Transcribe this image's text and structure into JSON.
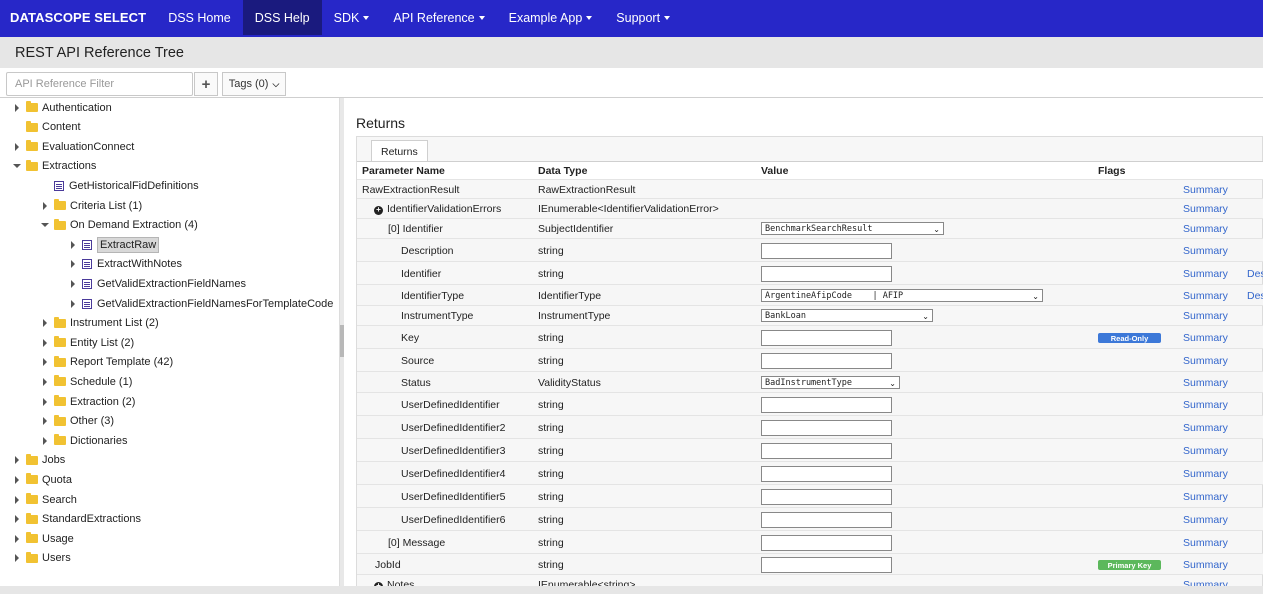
{
  "nav": {
    "brand": "DATASCOPE SELECT",
    "items": [
      {
        "label": "DSS Home",
        "caret": false,
        "active": false
      },
      {
        "label": "DSS Help",
        "caret": false,
        "active": true
      },
      {
        "label": "SDK",
        "caret": true,
        "active": false
      },
      {
        "label": "API Reference",
        "caret": true,
        "active": false
      },
      {
        "label": "Example App",
        "caret": true,
        "active": false
      },
      {
        "label": "Support",
        "caret": true,
        "active": false
      }
    ]
  },
  "page": {
    "title": "REST API Reference Tree"
  },
  "filter": {
    "placeholder": "API Reference Filter",
    "add_icon": "plus-icon",
    "tags_label": "Tags (0)"
  },
  "tree": [
    {
      "label": "Authentication",
      "level": 0,
      "toggle": "right",
      "icon": "folder"
    },
    {
      "label": "Content",
      "level": 0,
      "toggle": "none",
      "icon": "folder"
    },
    {
      "label": "EvaluationConnect",
      "level": 0,
      "toggle": "right",
      "icon": "folder"
    },
    {
      "label": "Extractions",
      "level": 0,
      "toggle": "down",
      "icon": "folder"
    },
    {
      "label": "GetHistoricalFidDefinitions",
      "level": 1,
      "toggle": "none",
      "icon": "method"
    },
    {
      "label": "Criteria List (1)",
      "level": 1,
      "toggle": "right",
      "icon": "folder"
    },
    {
      "label": "On Demand Extraction (4)",
      "level": 1,
      "toggle": "down",
      "icon": "folder"
    },
    {
      "label": "ExtractRaw",
      "level": 2,
      "toggle": "right",
      "icon": "method",
      "selected": true
    },
    {
      "label": "ExtractWithNotes",
      "level": 2,
      "toggle": "right",
      "icon": "method"
    },
    {
      "label": "GetValidExtractionFieldNames",
      "level": 2,
      "toggle": "right",
      "icon": "method"
    },
    {
      "label": "GetValidExtractionFieldNamesForTemplateCode",
      "level": 2,
      "toggle": "right",
      "icon": "method"
    },
    {
      "label": "Instrument List (2)",
      "level": 1,
      "toggle": "right",
      "icon": "folder"
    },
    {
      "label": "Entity List (2)",
      "level": 1,
      "toggle": "right",
      "icon": "folder"
    },
    {
      "label": "Report Template (42)",
      "level": 1,
      "toggle": "right",
      "icon": "folder"
    },
    {
      "label": "Schedule (1)",
      "level": 1,
      "toggle": "right",
      "icon": "folder"
    },
    {
      "label": "Extraction (2)",
      "level": 1,
      "toggle": "right",
      "icon": "folder"
    },
    {
      "label": "Other (3)",
      "level": 1,
      "toggle": "right",
      "icon": "folder"
    },
    {
      "label": "Dictionaries",
      "level": 1,
      "toggle": "right",
      "icon": "folder"
    },
    {
      "label": "Jobs",
      "level": 0,
      "toggle": "right",
      "icon": "folder"
    },
    {
      "label": "Quota",
      "level": 0,
      "toggle": "right",
      "icon": "folder"
    },
    {
      "label": "Search",
      "level": 0,
      "toggle": "right",
      "icon": "folder"
    },
    {
      "label": "StandardExtractions",
      "level": 0,
      "toggle": "right",
      "icon": "folder"
    },
    {
      "label": "Usage",
      "level": 0,
      "toggle": "right",
      "icon": "folder"
    },
    {
      "label": "Users",
      "level": 0,
      "toggle": "right",
      "icon": "folder"
    }
  ],
  "returns": {
    "heading": "Returns",
    "tab": "Returns",
    "columns": [
      "Parameter Name",
      "Data Type",
      "Value",
      "Flags"
    ],
    "rows": [
      {
        "name": "RawExtractionResult",
        "indent": 0,
        "type": "RawExtractionResult",
        "value_kind": "none",
        "flag": "",
        "link": "Summary",
        "extra": ""
      },
      {
        "name": "IdentifierValidationErrors",
        "indent": 1,
        "plus": true,
        "type": "IEnumerable<IdentifierValidationError>",
        "value_kind": "none",
        "flag": "",
        "link": "Summary",
        "extra": ""
      },
      {
        "name": "[0] Identifier",
        "indent": 2,
        "type": "SubjectIdentifier",
        "value_kind": "select",
        "select_value": "BenchmarkSearchResult",
        "select_width": 183,
        "flag": "",
        "link": "Summary",
        "extra": ""
      },
      {
        "name": "Description",
        "indent": 3,
        "type": "string",
        "value_kind": "text",
        "flag": "",
        "link": "Summary",
        "extra": ""
      },
      {
        "name": "Identifier",
        "indent": 3,
        "type": "string",
        "value_kind": "text",
        "flag": "",
        "link": "Summary",
        "extra": "Des"
      },
      {
        "name": "IdentifierType",
        "indent": 3,
        "type": "IdentifierType",
        "value_kind": "select",
        "select_value": "ArgentineAfipCode    | AFIP",
        "select_width": 282,
        "flag": "",
        "link": "Summary",
        "extra": "Des"
      },
      {
        "name": "InstrumentType",
        "indent": 3,
        "type": "InstrumentType",
        "value_kind": "select",
        "select_value": "BankLoan",
        "select_width": 172,
        "flag": "",
        "link": "Summary",
        "extra": ""
      },
      {
        "name": "Key",
        "indent": 3,
        "type": "string",
        "value_kind": "text",
        "flag": "Read-Only",
        "flag_kind": "ro",
        "link": "Summary",
        "extra": ""
      },
      {
        "name": "Source",
        "indent": 3,
        "type": "string",
        "value_kind": "text",
        "flag": "",
        "link": "Summary",
        "extra": ""
      },
      {
        "name": "Status",
        "indent": 3,
        "type": "ValidityStatus",
        "value_kind": "select",
        "select_value": "BadInstrumentType",
        "select_width": 139,
        "flag": "",
        "link": "Summary",
        "extra": ""
      },
      {
        "name": "UserDefinedIdentifier",
        "indent": 3,
        "type": "string",
        "value_kind": "text",
        "flag": "",
        "link": "Summary",
        "extra": ""
      },
      {
        "name": "UserDefinedIdentifier2",
        "indent": 3,
        "type": "string",
        "value_kind": "text",
        "flag": "",
        "link": "Summary",
        "extra": ""
      },
      {
        "name": "UserDefinedIdentifier3",
        "indent": 3,
        "type": "string",
        "value_kind": "text",
        "flag": "",
        "link": "Summary",
        "extra": ""
      },
      {
        "name": "UserDefinedIdentifier4",
        "indent": 3,
        "type": "string",
        "value_kind": "text",
        "flag": "",
        "link": "Summary",
        "extra": ""
      },
      {
        "name": "UserDefinedIdentifier5",
        "indent": 3,
        "type": "string",
        "value_kind": "text",
        "flag": "",
        "link": "Summary",
        "extra": ""
      },
      {
        "name": "UserDefinedIdentifier6",
        "indent": 3,
        "type": "string",
        "value_kind": "text",
        "flag": "",
        "link": "Summary",
        "extra": ""
      },
      {
        "name": "[0] Message",
        "indent": 2,
        "type": "string",
        "value_kind": "text",
        "flag": "",
        "link": "Summary",
        "extra": ""
      },
      {
        "name": "JobId",
        "indent": 1,
        "type": "string",
        "value_kind": "text",
        "flag": "Primary Key",
        "flag_kind": "pk",
        "link": "Summary",
        "extra": ""
      },
      {
        "name": "Notes",
        "indent": 1,
        "plus": true,
        "type": "IEnumerable<string>",
        "value_kind": "none",
        "flag": "",
        "link": "Summary",
        "extra": ""
      }
    ]
  },
  "colors": {
    "nav": "#2727c8",
    "nav_active": "#1a1a7e",
    "link": "#3366cc",
    "read_only": "#3c78d8",
    "primary_key": "#5cb85c"
  }
}
